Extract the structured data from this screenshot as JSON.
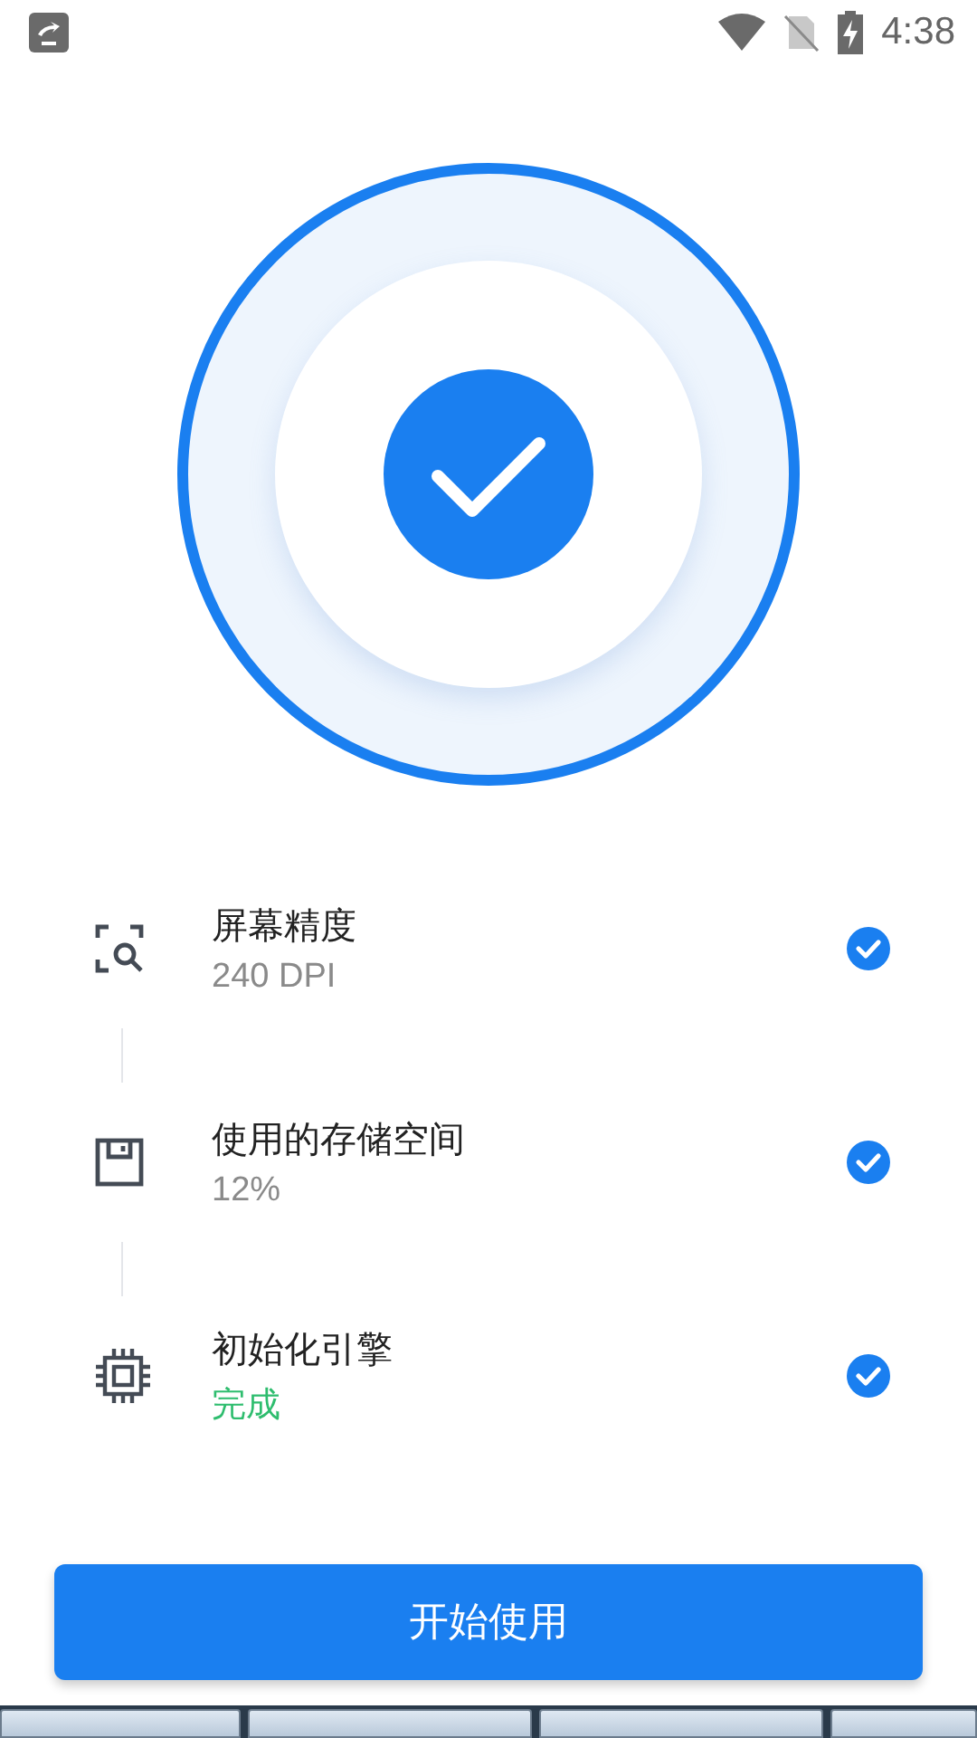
{
  "status_bar": {
    "time": "4:38"
  },
  "checks": [
    {
      "kind": "screen",
      "title": "屏幕精度",
      "value": "240 DPI",
      "color": "#8a8a8a",
      "checked": true
    },
    {
      "kind": "storage",
      "title": "使用的存储空间",
      "value": "12%",
      "color": "#8a8a8a",
      "checked": true
    },
    {
      "kind": "chip",
      "title": "初始化引擎",
      "value": "完成",
      "color": "#2ebd6e",
      "checked": true
    }
  ],
  "start_button": {
    "label": "开始使用"
  }
}
